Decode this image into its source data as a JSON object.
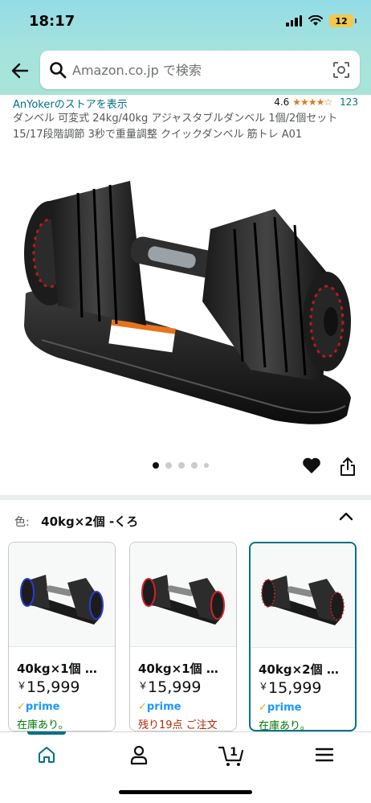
{
  "status_bar": {
    "time": "18:17",
    "battery": "12"
  },
  "search": {
    "placeholder": "Amazon.co.jp で検索"
  },
  "product": {
    "store_link": "AnYokerのストアを表示",
    "rating": "4.6",
    "stars": "★★★★☆",
    "review_count": "123",
    "title": "ダンベル 可変式 24kg/40kg アジャスタブルダンベル 1個/2個セット 15/17段階調節 3秒で重量調整 クイックダンベル 筋トレ A01",
    "image_icon": "adjustable-dumbbell-image",
    "image_count": 5,
    "current_image": 1
  },
  "color_selector": {
    "label": "色:",
    "value": "40kg×2個 -くろ"
  },
  "variants": [
    {
      "name": "40kg×1個 …",
      "yen": "￥",
      "price": "15,999",
      "prime_check": "✓",
      "prime": "prime",
      "stock": "在庫あり。",
      "stock_status": "in-stock",
      "accent": "#2a3cd6",
      "selected": false
    },
    {
      "name": "40kg×1個 …",
      "yen": "￥",
      "price": "15,999",
      "prime_check": "✓",
      "prime": "prime",
      "stock": "残り19点 ご注文",
      "stock_status": "low-stock",
      "accent": "#d6202a",
      "selected": false
    },
    {
      "name": "40kg×2個 …",
      "yen": "￥",
      "price": "15,999",
      "prime_check": "✓",
      "prime": "prime",
      "stock": "在庫あり。",
      "stock_status": "in-stock",
      "accent": "#c5222b",
      "selected": true
    }
  ],
  "bottom_nav": {
    "items": [
      {
        "icon": "home-icon",
        "active": true
      },
      {
        "icon": "account-icon",
        "active": false
      },
      {
        "icon": "cart-icon",
        "badge": "1",
        "active": false
      },
      {
        "icon": "menu-icon",
        "active": false
      }
    ]
  },
  "colors": {
    "link": "#007185",
    "star": "#de7921",
    "prime": "#1a98ff",
    "in_stock": "#007600",
    "low_stock": "#b12704",
    "header_gradient": "#93dce6"
  }
}
